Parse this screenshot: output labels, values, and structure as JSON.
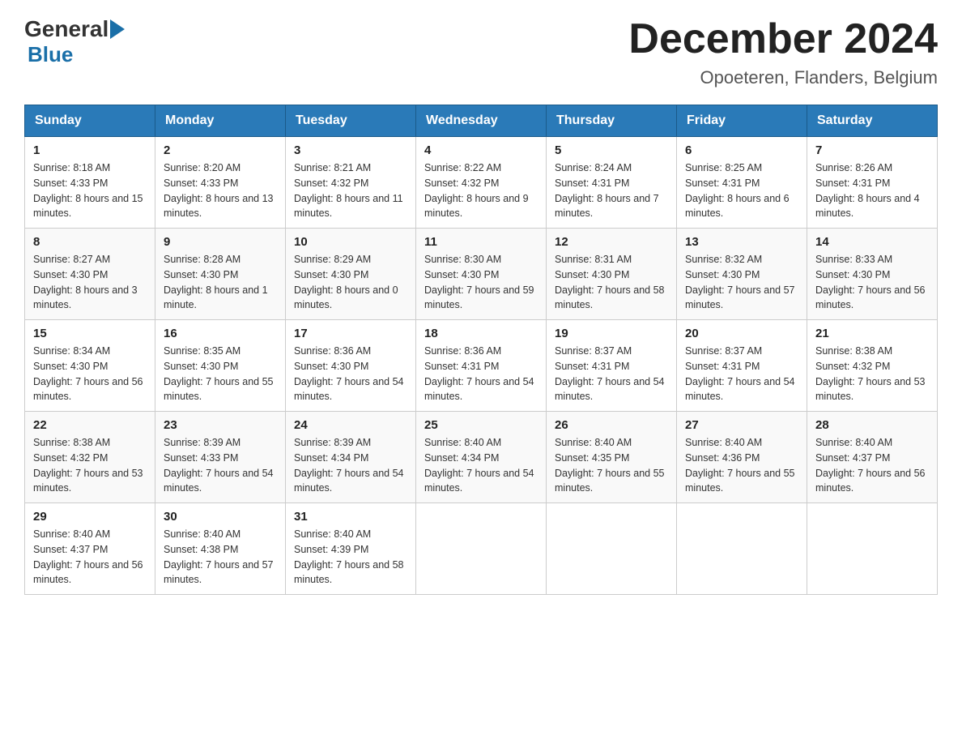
{
  "header": {
    "logo_general": "General",
    "logo_blue": "Blue",
    "month_title": "December 2024",
    "location": "Opoeteren, Flanders, Belgium"
  },
  "days_of_week": [
    "Sunday",
    "Monday",
    "Tuesday",
    "Wednesday",
    "Thursday",
    "Friday",
    "Saturday"
  ],
  "weeks": [
    [
      {
        "day": "1",
        "sunrise": "8:18 AM",
        "sunset": "4:33 PM",
        "daylight": "8 hours and 15 minutes."
      },
      {
        "day": "2",
        "sunrise": "8:20 AM",
        "sunset": "4:33 PM",
        "daylight": "8 hours and 13 minutes."
      },
      {
        "day": "3",
        "sunrise": "8:21 AM",
        "sunset": "4:32 PM",
        "daylight": "8 hours and 11 minutes."
      },
      {
        "day": "4",
        "sunrise": "8:22 AM",
        "sunset": "4:32 PM",
        "daylight": "8 hours and 9 minutes."
      },
      {
        "day": "5",
        "sunrise": "8:24 AM",
        "sunset": "4:31 PM",
        "daylight": "8 hours and 7 minutes."
      },
      {
        "day": "6",
        "sunrise": "8:25 AM",
        "sunset": "4:31 PM",
        "daylight": "8 hours and 6 minutes."
      },
      {
        "day": "7",
        "sunrise": "8:26 AM",
        "sunset": "4:31 PM",
        "daylight": "8 hours and 4 minutes."
      }
    ],
    [
      {
        "day": "8",
        "sunrise": "8:27 AM",
        "sunset": "4:30 PM",
        "daylight": "8 hours and 3 minutes."
      },
      {
        "day": "9",
        "sunrise": "8:28 AM",
        "sunset": "4:30 PM",
        "daylight": "8 hours and 1 minute."
      },
      {
        "day": "10",
        "sunrise": "8:29 AM",
        "sunset": "4:30 PM",
        "daylight": "8 hours and 0 minutes."
      },
      {
        "day": "11",
        "sunrise": "8:30 AM",
        "sunset": "4:30 PM",
        "daylight": "7 hours and 59 minutes."
      },
      {
        "day": "12",
        "sunrise": "8:31 AM",
        "sunset": "4:30 PM",
        "daylight": "7 hours and 58 minutes."
      },
      {
        "day": "13",
        "sunrise": "8:32 AM",
        "sunset": "4:30 PM",
        "daylight": "7 hours and 57 minutes."
      },
      {
        "day": "14",
        "sunrise": "8:33 AM",
        "sunset": "4:30 PM",
        "daylight": "7 hours and 56 minutes."
      }
    ],
    [
      {
        "day": "15",
        "sunrise": "8:34 AM",
        "sunset": "4:30 PM",
        "daylight": "7 hours and 56 minutes."
      },
      {
        "day": "16",
        "sunrise": "8:35 AM",
        "sunset": "4:30 PM",
        "daylight": "7 hours and 55 minutes."
      },
      {
        "day": "17",
        "sunrise": "8:36 AM",
        "sunset": "4:30 PM",
        "daylight": "7 hours and 54 minutes."
      },
      {
        "day": "18",
        "sunrise": "8:36 AM",
        "sunset": "4:31 PM",
        "daylight": "7 hours and 54 minutes."
      },
      {
        "day": "19",
        "sunrise": "8:37 AM",
        "sunset": "4:31 PM",
        "daylight": "7 hours and 54 minutes."
      },
      {
        "day": "20",
        "sunrise": "8:37 AM",
        "sunset": "4:31 PM",
        "daylight": "7 hours and 54 minutes."
      },
      {
        "day": "21",
        "sunrise": "8:38 AM",
        "sunset": "4:32 PM",
        "daylight": "7 hours and 53 minutes."
      }
    ],
    [
      {
        "day": "22",
        "sunrise": "8:38 AM",
        "sunset": "4:32 PM",
        "daylight": "7 hours and 53 minutes."
      },
      {
        "day": "23",
        "sunrise": "8:39 AM",
        "sunset": "4:33 PM",
        "daylight": "7 hours and 54 minutes."
      },
      {
        "day": "24",
        "sunrise": "8:39 AM",
        "sunset": "4:34 PM",
        "daylight": "7 hours and 54 minutes."
      },
      {
        "day": "25",
        "sunrise": "8:40 AM",
        "sunset": "4:34 PM",
        "daylight": "7 hours and 54 minutes."
      },
      {
        "day": "26",
        "sunrise": "8:40 AM",
        "sunset": "4:35 PM",
        "daylight": "7 hours and 55 minutes."
      },
      {
        "day": "27",
        "sunrise": "8:40 AM",
        "sunset": "4:36 PM",
        "daylight": "7 hours and 55 minutes."
      },
      {
        "day": "28",
        "sunrise": "8:40 AM",
        "sunset": "4:37 PM",
        "daylight": "7 hours and 56 minutes."
      }
    ],
    [
      {
        "day": "29",
        "sunrise": "8:40 AM",
        "sunset": "4:37 PM",
        "daylight": "7 hours and 56 minutes."
      },
      {
        "day": "30",
        "sunrise": "8:40 AM",
        "sunset": "4:38 PM",
        "daylight": "7 hours and 57 minutes."
      },
      {
        "day": "31",
        "sunrise": "8:40 AM",
        "sunset": "4:39 PM",
        "daylight": "7 hours and 58 minutes."
      },
      null,
      null,
      null,
      null
    ]
  ]
}
